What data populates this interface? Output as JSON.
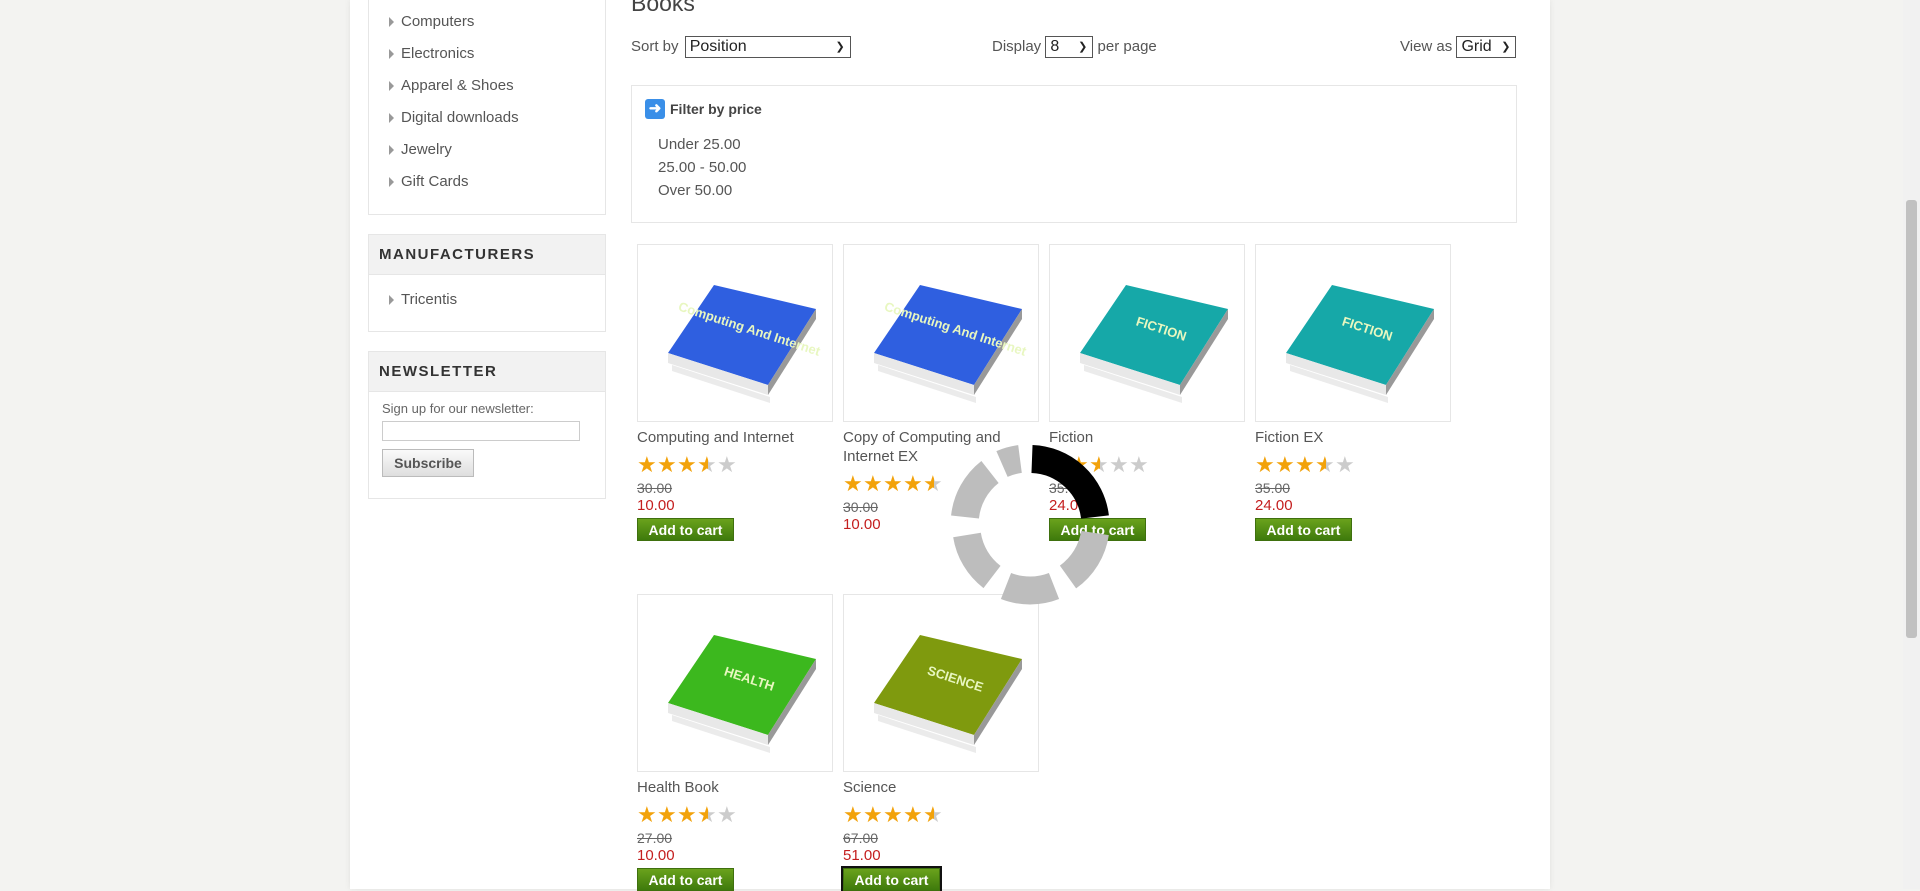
{
  "sidebar": {
    "categories": [
      "Computers",
      "Electronics",
      "Apparel & Shoes",
      "Digital downloads",
      "Jewelry",
      "Gift Cards"
    ],
    "manufacturers_title": "MANUFACTURERS",
    "manufacturers": [
      "Tricentis"
    ],
    "newsletter_title": "NEWSLETTER",
    "newsletter_label": "Sign up for our newsletter:",
    "newsletter_value": "",
    "subscribe_label": "Subscribe"
  },
  "main": {
    "title": "Books",
    "sort_label": "Sort by",
    "sort_value": "Position",
    "display_label": "Display",
    "display_value": "8",
    "per_page_label": "per page",
    "view_label": "View as",
    "view_value": "Grid",
    "filter_title": "Filter by price",
    "filter_options": [
      "Under 25.00",
      "25.00 - 50.00",
      "Over 50.00"
    ]
  },
  "products": [
    {
      "name": "Computing and Internet",
      "rating": 3.5,
      "old_price": "30.00",
      "price": "10.00",
      "button": "Add to cart",
      "cover_text": "Computing And Internet",
      "cover_color": "#2f5fe0"
    },
    {
      "name": "Copy of Computing and Internet EX",
      "rating": 4.5,
      "old_price": "30.00",
      "price": "10.00",
      "button": "Add to cart",
      "cover_text": "Computing And Internet",
      "cover_color": "#2f5fe0"
    },
    {
      "name": "Fiction",
      "rating": 2.5,
      "old_price": "35.00",
      "price": "24.00",
      "button": "Add to cart",
      "cover_text": "FICTION",
      "cover_color": "#16a8a8"
    },
    {
      "name": "Fiction EX",
      "rating": 3.5,
      "old_price": "35.00",
      "price": "24.00",
      "button": "Add to cart",
      "cover_text": "FICTION",
      "cover_color": "#16a8a8"
    },
    {
      "name": "Health Book",
      "rating": 3.5,
      "old_price": "27.00",
      "price": "10.00",
      "button": "Add to cart",
      "cover_text": "HEALTH",
      "cover_color": "#3cb81e"
    },
    {
      "name": "Science",
      "rating": 4.5,
      "old_price": "67.00",
      "price": "51.00",
      "button": "Add to cart",
      "cover_text": "SCIENCE",
      "cover_color": "#7f9a0e"
    }
  ],
  "colors": {
    "price": "#c41e1e",
    "button": "#4f8c14",
    "star": "#f2a20b"
  }
}
